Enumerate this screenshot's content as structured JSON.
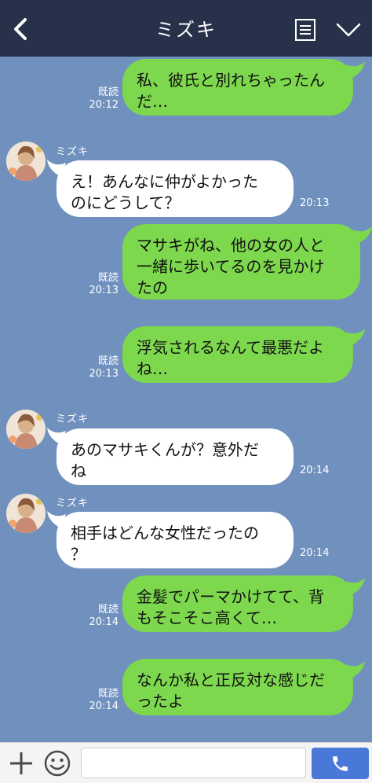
{
  "header": {
    "title": "ミズキ"
  },
  "messages": [
    {
      "from": "me",
      "text": "私、彼氏と別れちゃったん\nだ…",
      "read": "既読",
      "time": "20:12"
    },
    {
      "from": "them",
      "sender": "ミズキ",
      "text": "え！あんなに仲がよかった\nのにどうして？",
      "time": "20:13"
    },
    {
      "from": "me",
      "text": "マサキがね、他の女の人と\n一緒に歩いてるのを見かけ\nたの",
      "read": "既読",
      "time": "20:13"
    },
    {
      "from": "me",
      "text": "浮気されるなんて最悪だよ\nね…",
      "read": "既読",
      "time": "20:13"
    },
    {
      "from": "them",
      "sender": "ミズキ",
      "text": "あのマサキくんが？意外だ\nね",
      "time": "20:14"
    },
    {
      "from": "them",
      "sender": "ミズキ",
      "text": "相手はどんな女性だったの\n？",
      "time": "20:14"
    },
    {
      "from": "me",
      "text": "金髪でパーマかけてて、背\nもそこそこ高くて…",
      "read": "既読",
      "time": "20:14"
    },
    {
      "from": "me",
      "text": "なんか私と正反対な感じだ\nったよ",
      "read": "既読",
      "time": "20:14"
    }
  ],
  "colors": {
    "header": "#27324a",
    "background": "#7090be",
    "my_bubble": "#7dd84e",
    "their_bubble": "#ffffff",
    "call_button": "#4a78d8"
  },
  "icons": {
    "back": "chevron-left-icon",
    "menu": "list-icon",
    "collapse": "chevron-down-icon",
    "add": "plus-icon",
    "emoji": "smile-icon",
    "call": "phone-icon"
  }
}
